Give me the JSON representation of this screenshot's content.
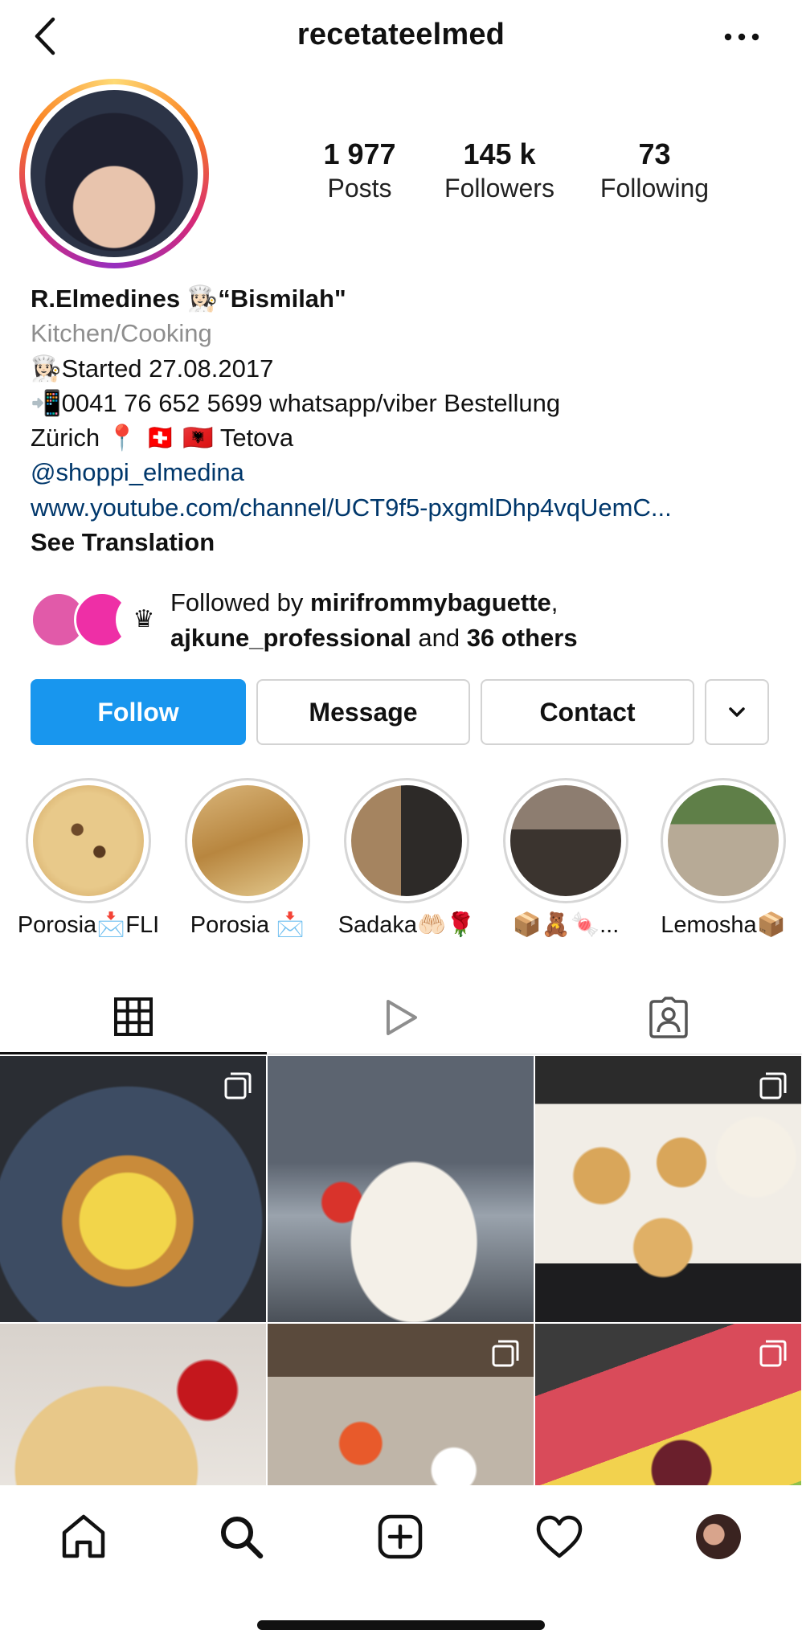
{
  "header": {
    "username": "recetateelmed"
  },
  "stats": [
    {
      "value": "1 977",
      "label": "Posts"
    },
    {
      "value": "145 k",
      "label": "Followers"
    },
    {
      "value": "73",
      "label": "Following"
    }
  ],
  "bio": {
    "name": "R.Elmedines 👩🏻‍🍳“Bismilah\"",
    "category": "Kitchen/Cooking",
    "line1": "👩🏻‍🍳Started 27.08.2017",
    "line2": "📲0041 76 652 5699 whatsapp/viber Bestellung",
    "line3": "Zürich 📍 🇨🇭 🇦🇱 Tetova",
    "mention": "@shoppi_elmedina",
    "link": "www.youtube.com/channel/UCT9f5-pxgmlDhp4vqUemC...",
    "translate": "See Translation"
  },
  "followed_by": {
    "prefix": "Followed by ",
    "user1": "mirifrommybaguette",
    "sep": ",",
    "user2": "ajkune_professional",
    "and": " and ",
    "others": "36 others",
    "badge": "♛"
  },
  "actions": {
    "follow": "Follow",
    "message": "Message",
    "contact": "Contact"
  },
  "highlights": [
    {
      "label": "Porosia📩FLI"
    },
    {
      "label": "Porosia 📩"
    },
    {
      "label": "Sadaka🤲🏻🌹"
    },
    {
      "label": "📦🧸🍬..."
    },
    {
      "label": "Lemosha📦"
    }
  ],
  "colors": {
    "follow_button": "#1896ee",
    "link": "#00376b",
    "category": "#8e8e8e"
  },
  "icons": {
    "back": "chevron-left-icon",
    "more": "more-horizontal-icon",
    "grid": "grid-icon",
    "reels": "play-icon",
    "tagged": "tagged-user-icon",
    "home": "home-icon",
    "search": "search-icon",
    "create": "plus-square-icon",
    "activity": "heart-icon",
    "profile": "profile-avatar-icon"
  }
}
